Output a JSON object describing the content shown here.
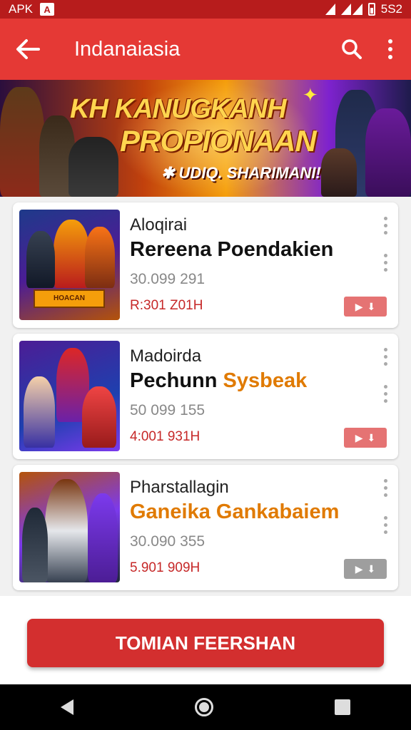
{
  "status_bar": {
    "carrier": "APK",
    "app_icon": "A",
    "time": "5S2",
    "icons": [
      "wifi-icon",
      "signal-icon",
      "battery-icon"
    ]
  },
  "app_bar": {
    "title": "Indanaiasia",
    "icons": [
      "back-arrow-icon",
      "search-icon",
      "more-vert-icon"
    ]
  },
  "banner": {
    "headline_1": "KH KANUGKANH",
    "headline_2": "PROPIONAAN",
    "tagline": "✱ UDIQ. SHARIMANI!"
  },
  "games": [
    {
      "category": "Aloqirai",
      "name": "Rereena Poendakien",
      "name_accent": "",
      "meta": "30.099 291",
      "price": "R:301 Z01H",
      "install_color": "#e57373",
      "thumb_caption": "HOACAN"
    },
    {
      "category": "Madoirda",
      "name": "Pechunn ",
      "name_accent": "Sysbeak",
      "meta": "50 099 155",
      "price": "4:001 931H",
      "install_color": "#e57373",
      "thumb_caption": ""
    },
    {
      "category": "Pharstallagin",
      "name": "",
      "name_accent": "Ganeika Gankabaiem",
      "meta": "30.090 355",
      "price": "5.901 909H",
      "install_color": "#9e9e9e",
      "thumb_caption": ""
    }
  ],
  "cta": {
    "label": "TOMIAN FEERSHAN"
  },
  "nav_bar": {
    "icons": [
      "nav-back-icon",
      "nav-home-icon",
      "nav-recents-icon"
    ]
  }
}
